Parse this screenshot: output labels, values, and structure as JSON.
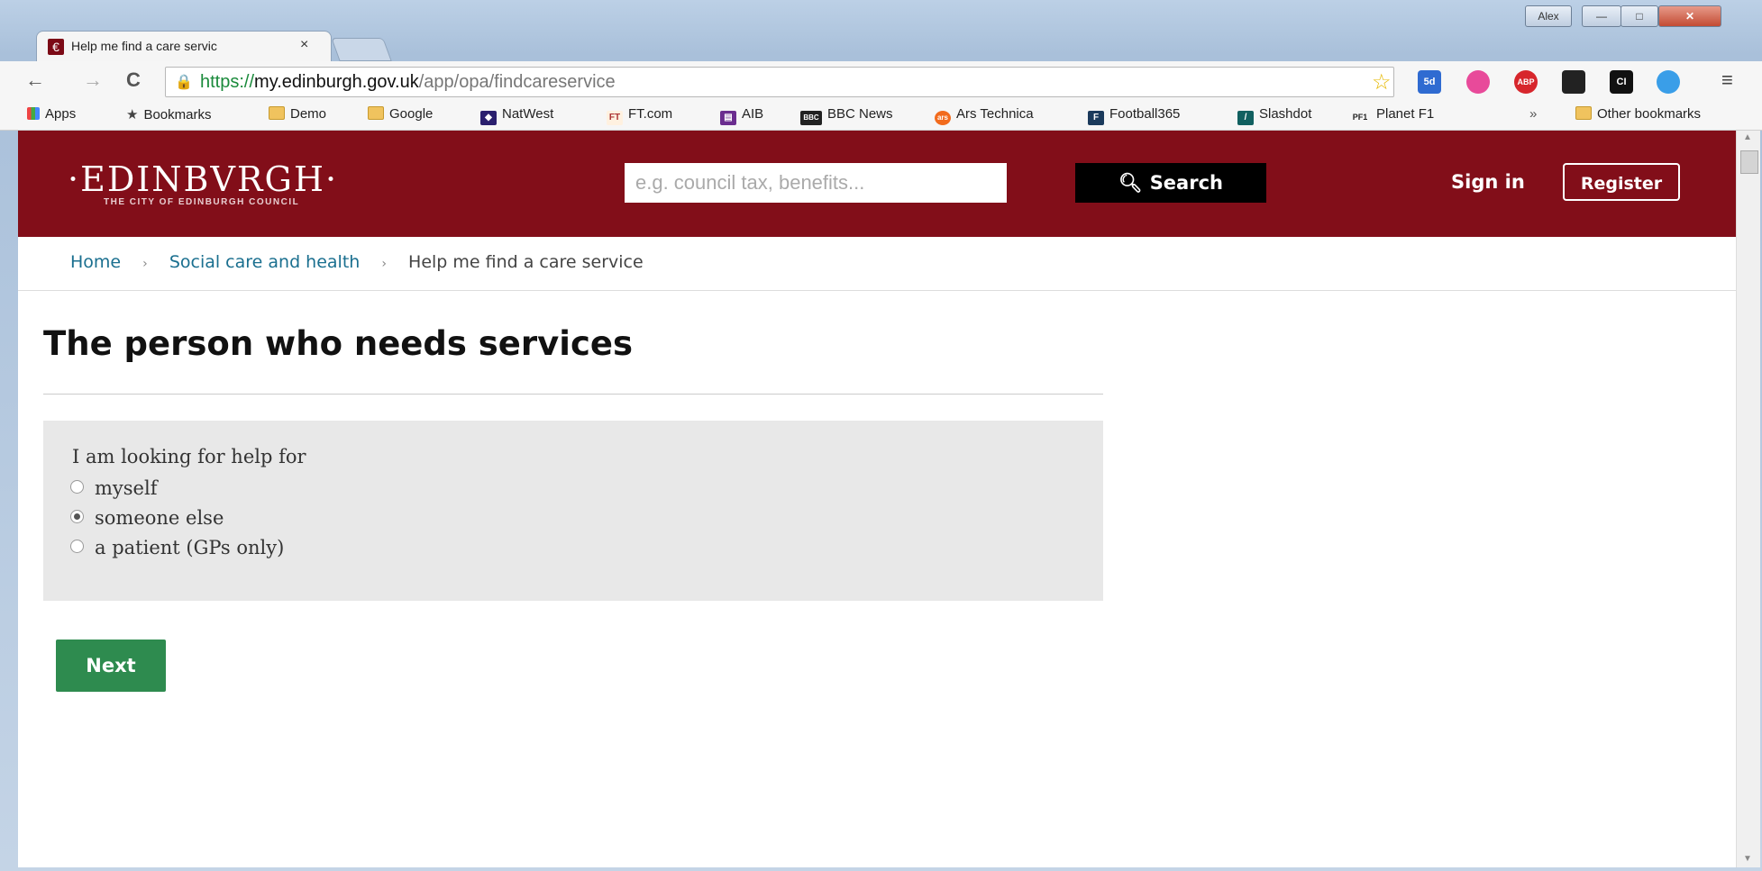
{
  "window": {
    "user_badge": "Alex",
    "minimize_glyph": "—",
    "maximize_glyph": "□",
    "close_glyph": "✕"
  },
  "tab": {
    "favicon_glyph": "€",
    "title": "Help me find a care servic",
    "close_glyph": "×"
  },
  "toolbar": {
    "back_glyph": "←",
    "forward_glyph": "→",
    "reload_glyph": "C",
    "url_scheme": "https://",
    "url_host": "my.edinburgh.gov.uk",
    "url_path": "/app/opa/findcareservice",
    "star_glyph": "☆",
    "menu_glyph": "≡",
    "extensions": [
      {
        "icon": "5d-extension-icon",
        "label": "5d",
        "color": "#2f6bd1"
      },
      {
        "icon": "color-wheel-icon",
        "label": "",
        "color": "#e84a9a"
      },
      {
        "icon": "adblock-plus-icon",
        "label": "ABP",
        "color": "#d7262c"
      },
      {
        "icon": "dark-mode-icon",
        "label": "",
        "color": "#222222"
      },
      {
        "icon": "ci-icon",
        "label": "CI",
        "color": "#111111"
      },
      {
        "icon": "cloud-icon",
        "label": "",
        "color": "#3a9ee8"
      }
    ]
  },
  "bookmarks": {
    "apps": "Apps",
    "bookmarks": "Bookmarks",
    "items": [
      "Demo",
      "Google",
      "NatWest",
      "FT.com",
      "AIB",
      "BBC News",
      "Ars Technica",
      "Football365",
      "Slashdot",
      "Planet F1"
    ],
    "overflow": "»",
    "other": "Other bookmarks"
  },
  "site": {
    "logo": "·EDINBVRGH·",
    "logo_sub": "THE CITY OF EDINBURGH COUNCIL",
    "search_placeholder": "e.g. council tax, benefits...",
    "search_button": "Search",
    "sign_in": "Sign in",
    "register": "Register",
    "brand_color": "#820e19"
  },
  "breadcrumb": {
    "items": [
      "Home",
      "Social care and health",
      "Help me find a care service"
    ],
    "separator": "›"
  },
  "main": {
    "heading": "The person who needs services",
    "question": "I am looking for help for",
    "options": [
      {
        "label": "myself",
        "checked": false
      },
      {
        "label": "someone else",
        "checked": true
      },
      {
        "label": "a patient (GPs only)",
        "checked": false
      }
    ],
    "next_button": "Next"
  }
}
